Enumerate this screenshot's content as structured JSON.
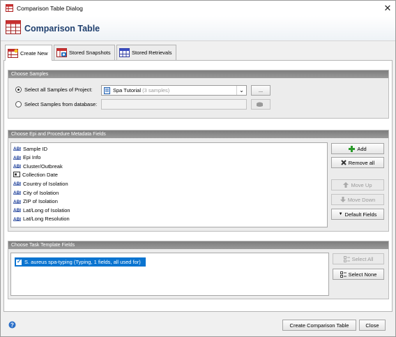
{
  "window": {
    "title": "Comparison Table Dialog",
    "close_glyph": "✕"
  },
  "header": {
    "title": "Comparison Table"
  },
  "tabs": [
    {
      "label": "Create New",
      "active": true
    },
    {
      "label": "Stored Snapshots",
      "active": false
    },
    {
      "label": "Stored Retrievals",
      "active": false
    }
  ],
  "samples": {
    "heading": "Choose Samples",
    "option_project_label": "Select all Samples of Project:",
    "project_value": "Spa Tutorial",
    "project_count": "(3 samples)",
    "browse_label": "...",
    "option_db_label": "Select Samples from database:",
    "db_value": ""
  },
  "metadata": {
    "heading": "Choose Epi and Procedure Metadata Fields",
    "fields": [
      {
        "label": "Sample ID",
        "icon": "text-field-icon"
      },
      {
        "label": "Epi Info",
        "icon": "text-field-icon"
      },
      {
        "label": "Cluster/Outbreak",
        "icon": "text-field-icon"
      },
      {
        "label": "Collection Date",
        "icon": "date-field-icon"
      },
      {
        "label": "Country of Isolation",
        "icon": "text-field-icon"
      },
      {
        "label": "City of Isolation",
        "icon": "text-field-icon"
      },
      {
        "label": "ZIP of Isolation",
        "icon": "text-field-icon"
      },
      {
        "label": "Lat/Long of Isolation",
        "icon": "text-field-icon"
      },
      {
        "label": "Lat/Long Resolution",
        "icon": "text-field-icon"
      }
    ],
    "add_label": "Add",
    "remove_all_label": "Remove all",
    "move_up_label": "Move Up",
    "move_down_label": "Move Down",
    "default_fields_label": "Default Fields"
  },
  "tasks": {
    "heading": "Choose Task Template Fields",
    "items": [
      {
        "label": "S. aureus spa-typing (Typing, 1 fields, all used for)",
        "checked": true
      }
    ],
    "select_all_label": "Select All",
    "select_none_label": "Select None"
  },
  "footer": {
    "create_label": "Create Comparison Table",
    "close_label": "Close"
  },
  "colors": {
    "accent": "#1f3f6e",
    "selection": "#0a74d0",
    "group_header": "#8a8a8a"
  }
}
